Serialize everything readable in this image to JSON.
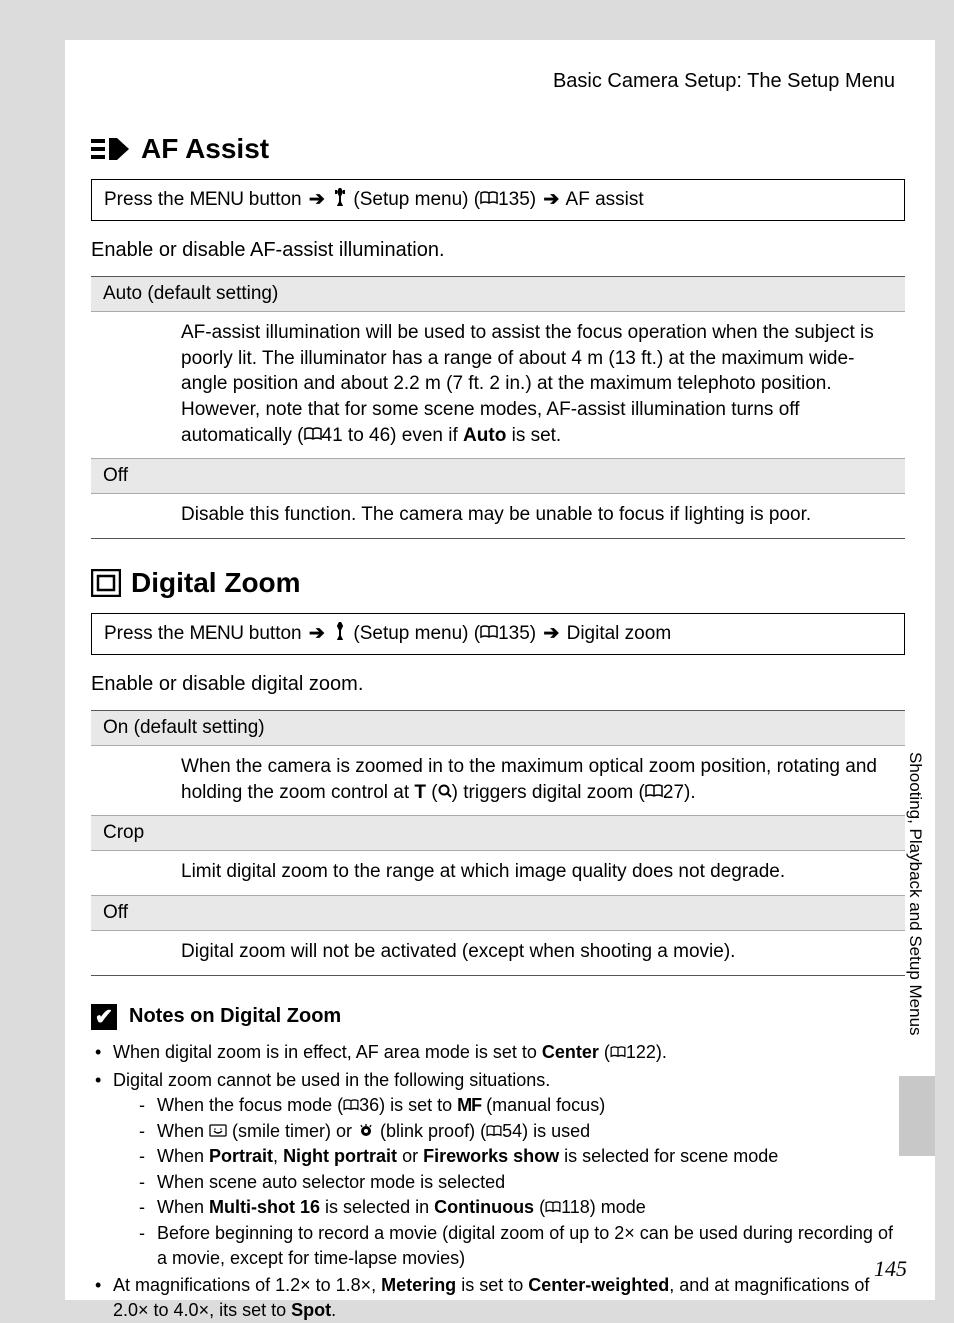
{
  "header": "Basic Camera Setup: The Setup Menu",
  "page_number": "145",
  "side_tab": "Shooting, Playback and Setup Menus",
  "nav": {
    "press_the": "Press the ",
    "menu_btn": "MENU",
    "button": " button ",
    "setup_menu": " (Setup menu) (",
    "ref135": "135) ",
    "arrow": "➔"
  },
  "glyphs": {
    "book": "📖",
    "wrench": "🔧",
    "t_bold": "T",
    "magnify": "🔍",
    "mf": "MF",
    "smile": "😊",
    "blink": "👁"
  },
  "af": {
    "title": "AF Assist",
    "nav_end": " AF assist",
    "intro": "Enable or disable AF-assist illumination.",
    "opt1_h": "Auto (default setting)",
    "opt1_b1": "AF-assist illumination will be used to assist the focus operation when the subject is poorly lit. The illuminator has a range of about 4 m (13 ft.) at the maximum wide-angle position and about 2.2 m (7 ft. 2 in.) at the maximum telephoto position. However, note that for some scene modes, AF-assist illumination turns off automatically (",
    "opt1_ref": "41 to 46) even if ",
    "opt1_auto": "Auto",
    "opt1_end": " is set.",
    "opt2_h": "Off",
    "opt2_b": "Disable this function. The camera may be unable to focus if lighting is poor."
  },
  "dz": {
    "title": "Digital Zoom",
    "nav_end": " Digital zoom",
    "intro": "Enable or disable digital zoom.",
    "opt1_h": "On (default setting)",
    "opt1_b1": "When the camera is zoomed in to the maximum optical zoom position, rotating and holding the zoom control at ",
    "opt1_b2": " (",
    "opt1_b3": ") triggers digital zoom (",
    "opt1_ref": "27).",
    "opt2_h": "Crop",
    "opt2_b": "Limit digital zoom to the range at which image quality does not degrade.",
    "opt3_h": "Off",
    "opt3_b": "Digital zoom will not be activated (except when shooting a movie)."
  },
  "notes": {
    "title": "Notes on Digital Zoom",
    "n1a": "When digital zoom is in effect, AF area mode is set to ",
    "n1b": "Center",
    "n1c": " (",
    "n1ref": "122).",
    "n2": "Digital zoom cannot be used in the following situations.",
    "s1a": "When the focus mode (",
    "s1ref": "36) is set to ",
    "s1b": " (manual focus)",
    "s2a": "When ",
    "s2b": " (smile timer) or ",
    "s2c": " (blink proof) (",
    "s2ref": "54) is used",
    "s3a": "When ",
    "s3b": "Portrait",
    "s3c": ", ",
    "s3d": "Night portrait",
    "s3e": " or ",
    "s3f": "Fireworks show",
    "s3g": " is selected for scene mode",
    "s4": "When scene auto selector mode is selected",
    "s5a": "When ",
    "s5b": "Multi-shot 16",
    "s5c": " is selected in ",
    "s5d": "Continuous",
    "s5e": " (",
    "s5ref": "118) mode",
    "s6": "Before beginning to record a movie (digital zoom of up to 2× can be used during recording of a movie, except for time-lapse movies)",
    "n3a": "At magnifications of 1.2× to 1.8×, ",
    "n3b": "Metering",
    "n3c": " is set to ",
    "n3d": "Center-weighted",
    "n3e": ", and at magnifications of 2.0× to 4.0×, its set to ",
    "n3f": "Spot",
    "n3g": "."
  }
}
